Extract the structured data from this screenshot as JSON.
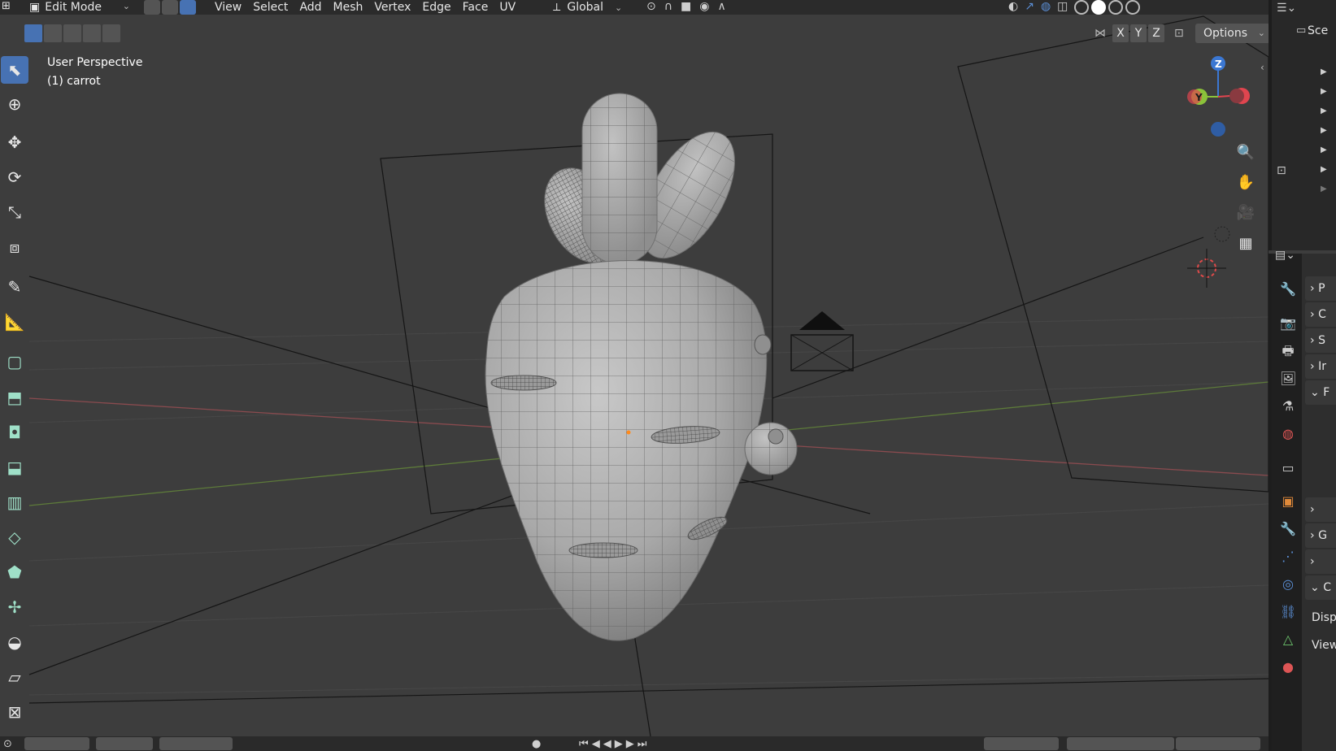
{
  "header": {
    "mode": "Edit Mode",
    "menus": [
      "View",
      "Select",
      "Add",
      "Mesh",
      "Vertex",
      "Edge",
      "Face",
      "UV"
    ],
    "orientation": "Global",
    "axis_buttons": [
      "X",
      "Y",
      "Z"
    ],
    "options_label": "Options"
  },
  "viewport": {
    "view_name": "User Perspective",
    "object_label": "(1) carrot"
  },
  "gizmo": {
    "z_label": "Z",
    "y_label": "Y",
    "colors": {
      "x": "#e0454f",
      "y": "#8bc23a",
      "z": "#3b77d2"
    }
  },
  "outliner": {
    "title": "Sce"
  },
  "properties": {
    "sections": [
      "P",
      "C",
      "S",
      "Ir",
      "F"
    ],
    "lower_sections": [
      "",
      "G",
      ""
    ],
    "open_section": "C",
    "rows": [
      "Disp",
      "View"
    ]
  },
  "toolbar": {
    "tools": [
      "select-box",
      "cursor",
      "move",
      "rotate",
      "scale",
      "transform",
      "annotate",
      "measure",
      "add-cube",
      "extrude",
      "inset",
      "bevel",
      "loop-cut",
      "knife",
      "poly-build",
      "spin",
      "smooth",
      "shear",
      "shrink-fatten"
    ]
  },
  "colors": {
    "accent": "#4772b3",
    "background": "#3d3d3d",
    "header": "#2b2b2b"
  }
}
